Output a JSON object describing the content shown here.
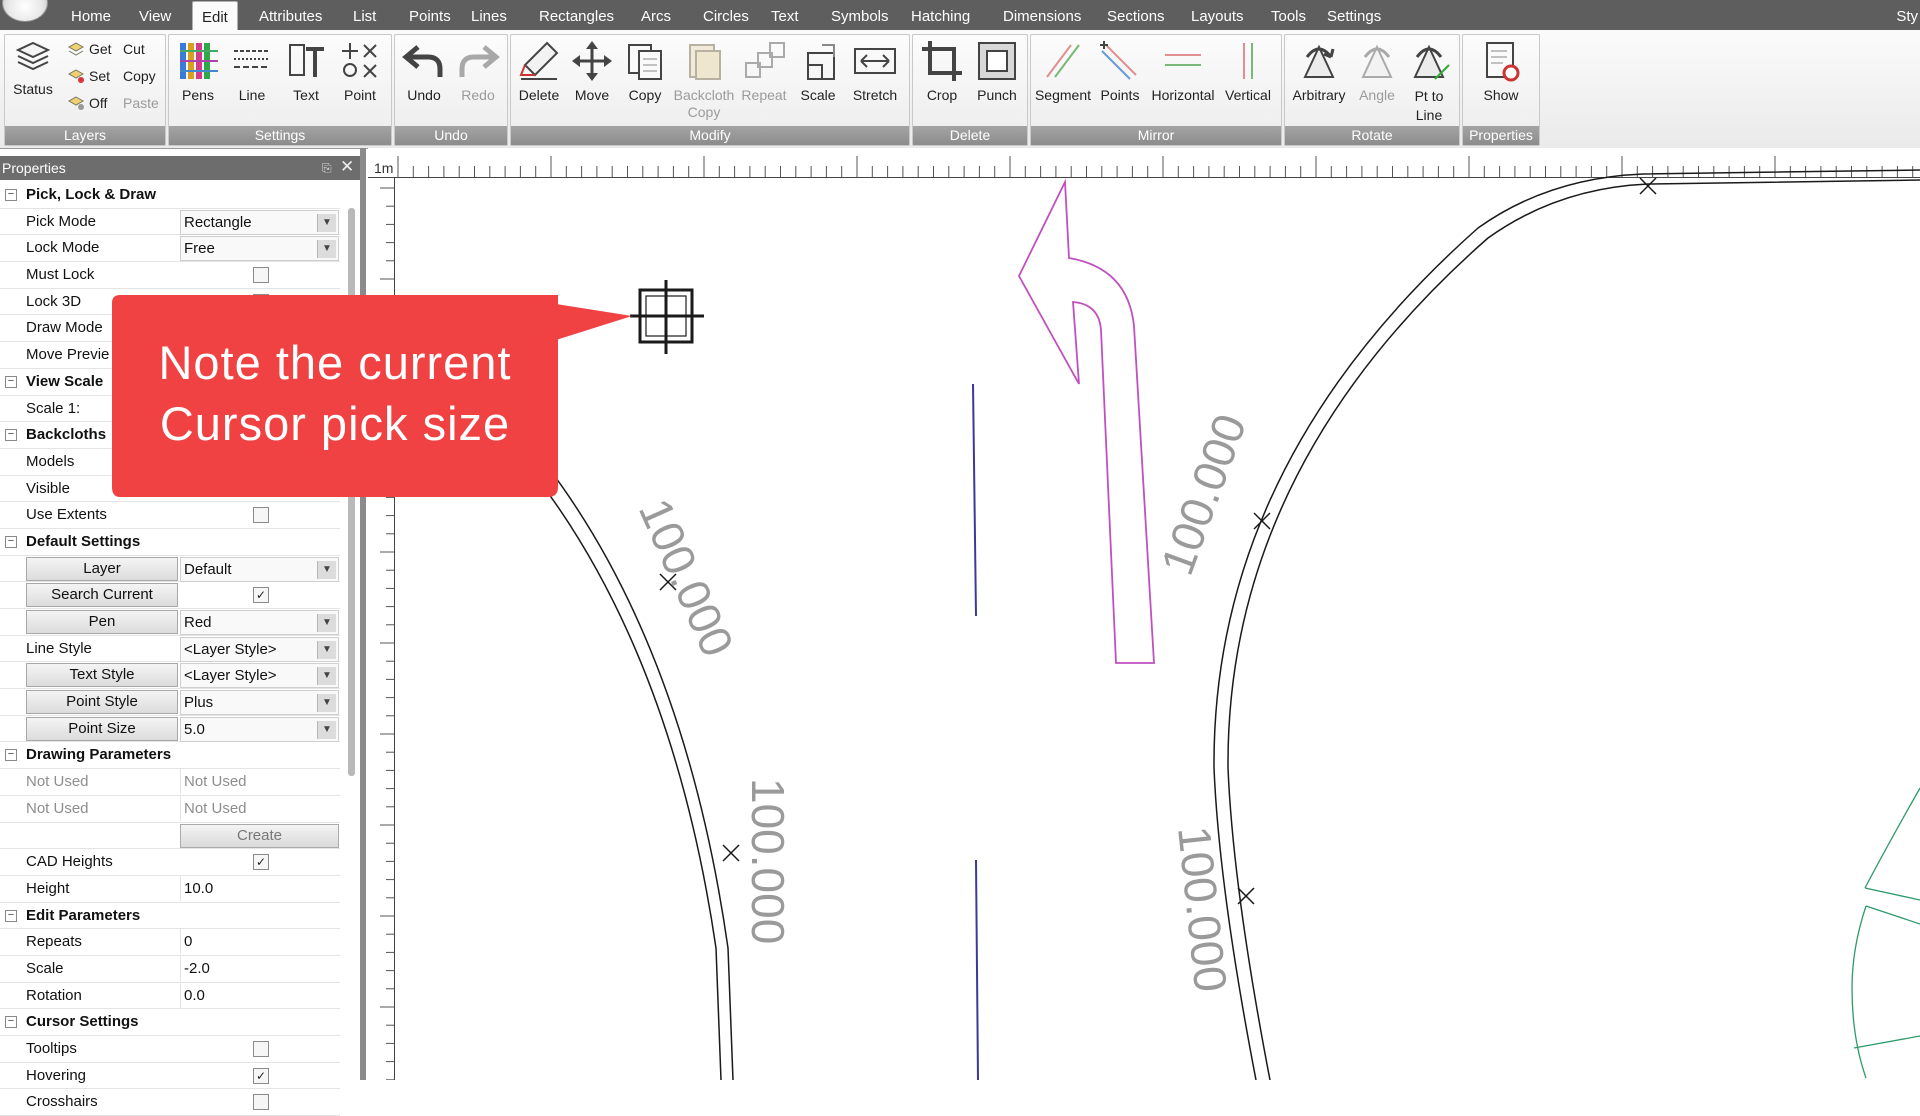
{
  "menubar": {
    "items": [
      "Home",
      "View",
      "Edit",
      "Attributes",
      "List",
      "Points",
      "Lines",
      "Rectangles",
      "Arcs",
      "Circles",
      "Text",
      "Symbols",
      "Hatching",
      "Dimensions",
      "Sections",
      "Layouts",
      "Tools",
      "Settings"
    ],
    "active": "Edit",
    "overflow_label": "Sty"
  },
  "ribbon": {
    "groups": {
      "layers": {
        "label": "Layers",
        "status": "Status",
        "get": "Get",
        "set": "Set",
        "off": "Off",
        "cut": "Cut",
        "copy": "Copy",
        "paste": "Paste"
      },
      "settings": {
        "label": "Settings",
        "pens": "Pens",
        "line": "Line",
        "text": "Text",
        "point": "Point"
      },
      "undo": {
        "label": "Undo",
        "undo": "Undo",
        "redo": "Redo"
      },
      "modify": {
        "label": "Modify",
        "delete": "Delete",
        "move": "Move",
        "copy": "Copy",
        "backcloth_copy": "Backcloth Copy",
        "repeat": "Repeat",
        "scale": "Scale",
        "stretch": "Stretch"
      },
      "delete": {
        "label": "Delete",
        "crop": "Crop",
        "punch": "Punch"
      },
      "mirror": {
        "label": "Mirror",
        "segment": "Segment",
        "points": "Points",
        "horizontal": "Horizontal",
        "vertical": "Vertical"
      },
      "rotate": {
        "label": "Rotate",
        "arbitrary": "Arbitrary",
        "angle": "Angle",
        "pt_to_line": "Pt to Line"
      },
      "properties": {
        "label": "Properties",
        "show": "Show"
      }
    }
  },
  "properties_panel": {
    "title": "Properties",
    "rows": [
      {
        "type": "cat",
        "name": "Pick, Lock & Draw"
      },
      {
        "type": "combo",
        "name": "Pick Mode",
        "value": "Rectangle"
      },
      {
        "type": "combo",
        "name": "Lock Mode",
        "value": "Free"
      },
      {
        "type": "check",
        "name": "Must Lock",
        "checked": false
      },
      {
        "type": "check",
        "name": "Lock 3D",
        "checked": false
      },
      {
        "type": "text",
        "name": "Draw Mode",
        "value": ""
      },
      {
        "type": "text",
        "name": "Move Previe",
        "value": ""
      },
      {
        "type": "cat",
        "name": "View Scale"
      },
      {
        "type": "text",
        "name": "Scale 1:",
        "value": ""
      },
      {
        "type": "cat",
        "name": "Backcloths"
      },
      {
        "type": "text",
        "name": "Models",
        "value": ""
      },
      {
        "type": "text",
        "name": "Visible",
        "value": ""
      },
      {
        "type": "check",
        "name": "Use Extents",
        "checked": false
      },
      {
        "type": "cat",
        "name": "Default Settings"
      },
      {
        "type": "btncombo",
        "name": "Layer",
        "value": "Default"
      },
      {
        "type": "btncheck",
        "name": "Search Current",
        "checked": true
      },
      {
        "type": "btncombo",
        "name": "Pen",
        "value": "Red"
      },
      {
        "type": "combo",
        "name": "Line Style",
        "value": "<Layer Style>"
      },
      {
        "type": "btncombo",
        "name": "Text Style",
        "value": "<Layer Style>"
      },
      {
        "type": "btncombo",
        "name": "Point Style",
        "value": "Plus"
      },
      {
        "type": "btncombo",
        "name": "Point Size",
        "value": "5.0"
      },
      {
        "type": "cat",
        "name": "Drawing Parameters"
      },
      {
        "type": "disabled",
        "name": "Not Used",
        "value": "Not Used"
      },
      {
        "type": "disabled",
        "name": "Not Used",
        "value": "Not Used"
      },
      {
        "type": "create",
        "name": "",
        "value": "Create"
      },
      {
        "type": "check",
        "name": "CAD Heights",
        "checked": true
      },
      {
        "type": "text",
        "name": "Height",
        "value": "10.0"
      },
      {
        "type": "cat",
        "name": "Edit Parameters"
      },
      {
        "type": "text",
        "name": "Repeats",
        "value": "0"
      },
      {
        "type": "text",
        "name": "Scale",
        "value": "-2.0"
      },
      {
        "type": "text",
        "name": "Rotation",
        "value": "0.0"
      },
      {
        "type": "cat",
        "name": "Cursor Settings"
      },
      {
        "type": "check",
        "name": "Tooltips",
        "checked": false
      },
      {
        "type": "check",
        "name": "Hovering",
        "checked": true
      },
      {
        "type": "check",
        "name": "Crosshairs",
        "checked": false
      }
    ]
  },
  "canvas": {
    "ruler_label": "1m",
    "labels": [
      "100.000",
      "100.000",
      "100.000",
      "100.000"
    ],
    "colors": {
      "arrow": "#c050c0",
      "centerline": "#3a3a9a",
      "curb": "#1a1a1a",
      "circle": "#2e9a6a",
      "label": "#9a9a9a"
    }
  },
  "callout": {
    "line1": "Note the current",
    "line2": "Cursor pick size",
    "color": "#f04242"
  }
}
